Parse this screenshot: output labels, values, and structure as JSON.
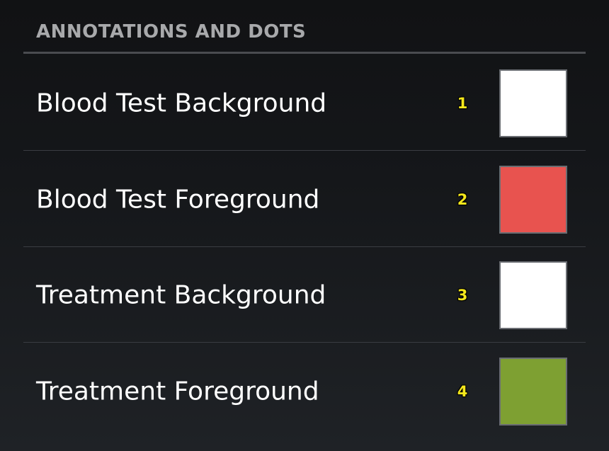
{
  "section": {
    "title": "ANNOTATIONS AND DOTS"
  },
  "rows": [
    {
      "label": "Blood Test Background",
      "marker": "1",
      "color": "#ffffff"
    },
    {
      "label": "Blood Test Foreground",
      "marker": "2",
      "color": "#e8534f"
    },
    {
      "label": "Treatment Background",
      "marker": "3",
      "color": "#ffffff"
    },
    {
      "label": "Treatment Foreground",
      "marker": "4",
      "color": "#7ea032"
    }
  ]
}
